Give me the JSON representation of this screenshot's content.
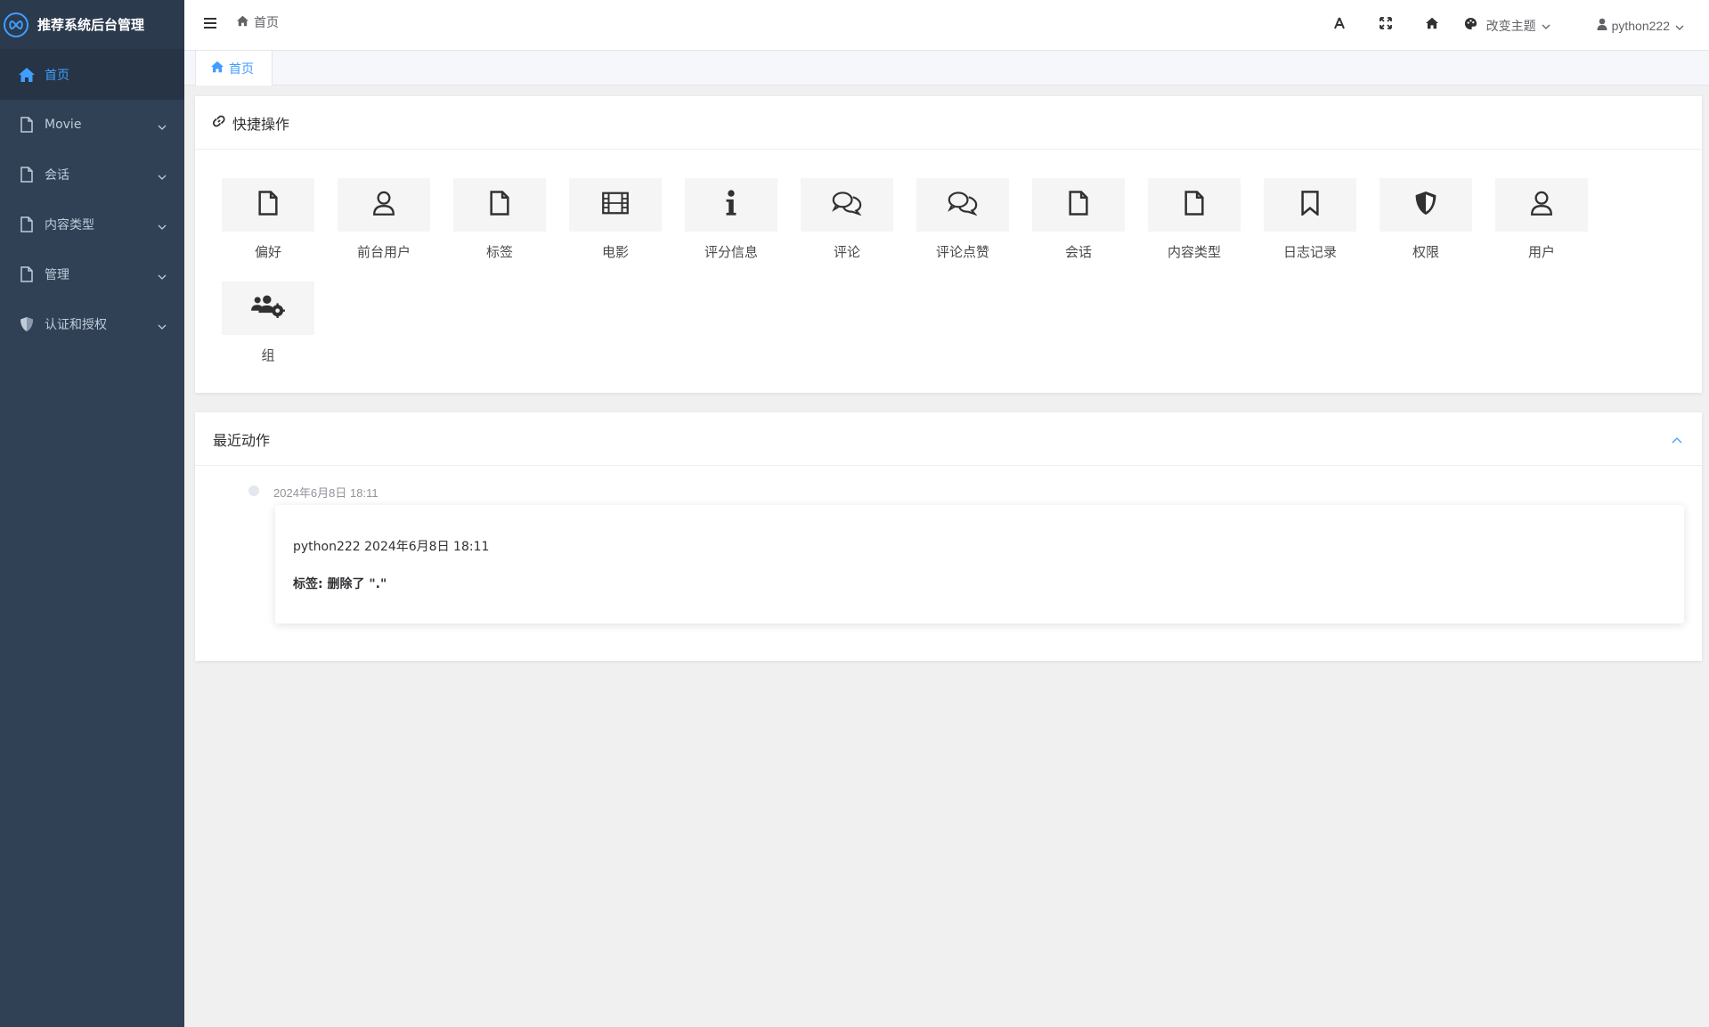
{
  "app": {
    "title": "推荐系统后台管理"
  },
  "sidebar": {
    "items": [
      {
        "label": "首页",
        "icon": "home-icon",
        "active": true
      },
      {
        "label": "Movie",
        "icon": "file-icon"
      },
      {
        "label": "会话",
        "icon": "file-icon"
      },
      {
        "label": "内容类型",
        "icon": "file-icon"
      },
      {
        "label": "管理",
        "icon": "file-icon"
      },
      {
        "label": "认证和授权",
        "icon": "shield-icon"
      }
    ]
  },
  "header": {
    "breadcrumb": "首页",
    "theme_label": "改变主题",
    "username": "python222"
  },
  "tabs": [
    {
      "label": "首页",
      "active": true
    }
  ],
  "quick": {
    "title": "快捷操作",
    "items": [
      {
        "label": "偏好",
        "icon": "file-icon"
      },
      {
        "label": "前台用户",
        "icon": "user-icon"
      },
      {
        "label": "标签",
        "icon": "file-icon"
      },
      {
        "label": "电影",
        "icon": "film-icon"
      },
      {
        "label": "评分信息",
        "icon": "info-icon"
      },
      {
        "label": "评论",
        "icon": "comments-icon"
      },
      {
        "label": "评论点赞",
        "icon": "comments-icon"
      },
      {
        "label": "会话",
        "icon": "file-icon"
      },
      {
        "label": "内容类型",
        "icon": "file-icon"
      },
      {
        "label": "日志记录",
        "icon": "bookmark-icon"
      },
      {
        "label": "权限",
        "icon": "shield-icon"
      },
      {
        "label": "用户",
        "icon": "user-icon"
      },
      {
        "label": "组",
        "icon": "users-cog-icon"
      }
    ]
  },
  "recent": {
    "title": "最近动作",
    "entries": [
      {
        "time": "2024年6月8日 18:11",
        "line1": "python222 2024年6月8日 18:11",
        "line2": "标签: 删除了 \".\""
      }
    ]
  },
  "colors": {
    "sidebar_bg": "#304156",
    "accent": "#409eff"
  }
}
